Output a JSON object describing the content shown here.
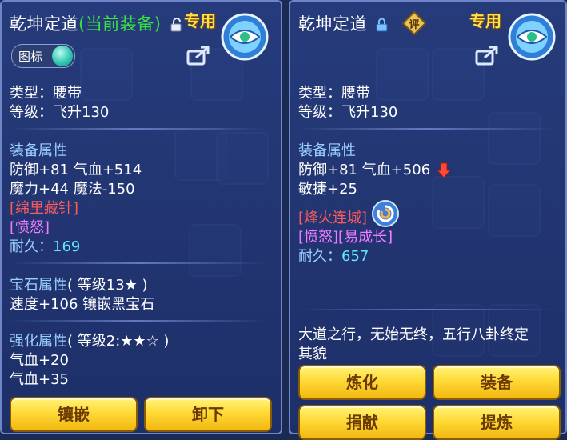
{
  "left": {
    "title_main": "乾坤定道",
    "title_status": "(当前装备)",
    "special_label": "专用",
    "toggle_label": "图标",
    "type_label": "类型：腰带",
    "level_label": "等级：飞升130",
    "attr_header": "装备属性",
    "attr_line1": "防御+81 气血+514",
    "attr_line2": "魔力+44 魔法-150",
    "effect1": "[绵里藏针]",
    "effect2": "[愤怒]",
    "durability_label": "耐久：",
    "durability_value": "169",
    "gem_header": "宝石属性",
    "gem_level": "( 等级13★ )",
    "gem_line": "速度+106 镶嵌黑宝石",
    "enhance_header": "强化属性",
    "enhance_level": "( 等级2:★★☆ )",
    "enhance_line1": "气血+20",
    "enhance_line2": "气血+35",
    "buttons": [
      "镶嵌",
      "卸下"
    ]
  },
  "right": {
    "title_main": "乾坤定道",
    "rate_badge": "评",
    "special_label": "专用",
    "type_label": "类型：腰带",
    "level_label": "等级：飞升130",
    "attr_header": "装备属性",
    "attr_line1": "防御+81 气血+506",
    "attr_line2": "敏捷+25",
    "effect1": "[烽火连城]",
    "effect2": "[愤怒][易成长]",
    "durability_label": "耐久：",
    "durability_value": "657",
    "description_line1": "大道之行，无始无终，五行八卦终定",
    "description_line2": "其貌",
    "buttons": [
      "炼化",
      "装备",
      "捐献",
      "提炼"
    ]
  },
  "colors": {
    "panel_bg": "#283e82",
    "header_blue": "#9ad0ff",
    "accent_yellow": "#ffd84a",
    "status_green": "#39e641",
    "effect_red": "#ff5b5b",
    "effect_magenta": "#f07cff",
    "value_cyan": "#5ee7ff",
    "button_gold": "#ffd936"
  },
  "icons": [
    "unlock-icon",
    "lock-icon",
    "rate-badge-icon",
    "belt-item-icon",
    "share-icon",
    "toggle-knob",
    "down-arrow-icon",
    "swirl-skill-icon"
  ]
}
